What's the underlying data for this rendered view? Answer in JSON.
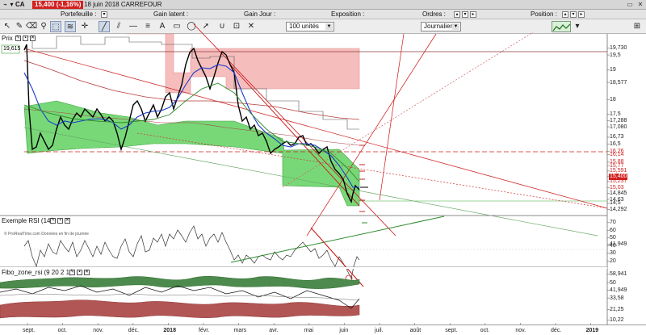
{
  "titlebar": {
    "symbol": "CA",
    "price_change": "15,400 (-1,16%)",
    "date_name": "18 juin 2018 CARREFOUR",
    "menu_arrow": "▾",
    "window_buttons": [
      "▭",
      "✕"
    ]
  },
  "info_row": [
    {
      "label": "Portefeuille :"
    },
    {
      "label": "Gain latent :"
    },
    {
      "label": "Gain Jour :"
    },
    {
      "label": "Exposition :"
    },
    {
      "label": "Ordres :"
    },
    {
      "label": "Position :"
    }
  ],
  "toolbar": {
    "quantity": "100 unités",
    "period": "Journalier"
  },
  "price_panel": {
    "label": "Prix",
    "left_badge": "19,615",
    "current_value": "15,400",
    "axis": [
      {
        "v": 19.73,
        "t": "19,730"
      },
      {
        "v": 19.5,
        "t": "19,5"
      },
      {
        "v": 19.0,
        "t": "19"
      },
      {
        "v": 18.577,
        "t": "18,577"
      },
      {
        "v": 18.0,
        "t": "18"
      },
      {
        "v": 17.5,
        "t": "17,5"
      },
      {
        "v": 17.288,
        "t": "17,288"
      },
      {
        "v": 17.08,
        "t": "17,080"
      },
      {
        "v": 16.73,
        "t": "16,73"
      },
      {
        "v": 16.5,
        "t": "16,5"
      },
      {
        "v": 16.26,
        "t": "16,26"
      },
      {
        "v": 16.14,
        "t": "16,14"
      },
      {
        "v": 15.89,
        "t": "15,88"
      },
      {
        "v": 15.775,
        "t": "15,77"
      },
      {
        "v": 15.591,
        "t": "15,591"
      },
      {
        "v": 15.4,
        "t": "15,40"
      },
      {
        "v": 15.237,
        "t": "15,237"
      },
      {
        "v": 15.035,
        "t": "15,03"
      },
      {
        "v": 14.845,
        "t": "14,845"
      },
      {
        "v": 14.634,
        "t": "14,63"
      },
      {
        "v": 14.5,
        "t": "14,5"
      },
      {
        "v": 14.292,
        "t": "14,292"
      }
    ],
    "watermark": "© ProRealTime.com  Données en fin de journée"
  },
  "rsi_panel": {
    "label": "Exemple RSI (14)",
    "axis": [
      {
        "v": 70,
        "t": "70"
      },
      {
        "v": 60,
        "t": "60"
      },
      {
        "v": 50,
        "t": "50"
      },
      {
        "v": 41.949,
        "t": "41,949"
      },
      {
        "v": 40,
        "t": "40"
      },
      {
        "v": 30,
        "t": "30"
      },
      {
        "v": 20,
        "t": "20"
      }
    ]
  },
  "fibo_panel": {
    "label": "Fibo_zone_rsi (9 20 2 1)",
    "axis": [
      {
        "v": 58.94,
        "t": "58,941"
      },
      {
        "v": 50,
        "t": "50"
      },
      {
        "v": 41.949,
        "t": "41,949"
      },
      {
        "v": 33.58,
        "t": "33,58"
      },
      {
        "v": 21.25,
        "t": "21,25"
      },
      {
        "v": 10.22,
        "t": "10,22"
      }
    ]
  },
  "xaxis": [
    {
      "t": "sept.",
      "bold": false
    },
    {
      "t": "oct.",
      "bold": false
    },
    {
      "t": "nov.",
      "bold": false
    },
    {
      "t": "déc.",
      "bold": false
    },
    {
      "t": "2018",
      "bold": true
    },
    {
      "t": "févr.",
      "bold": false
    },
    {
      "t": "mars",
      "bold": false
    },
    {
      "t": "avr.",
      "bold": false
    },
    {
      "t": "mai",
      "bold": false
    },
    {
      "t": "juin",
      "bold": false
    },
    {
      "t": "juil.",
      "bold": false
    },
    {
      "t": "août",
      "bold": false
    },
    {
      "t": "sept.",
      "bold": false
    },
    {
      "t": "oct.",
      "bold": false
    },
    {
      "t": "nov.",
      "bold": false
    },
    {
      "t": "déc.",
      "bold": false
    },
    {
      "t": "2019",
      "bold": true
    }
  ],
  "colors": {
    "ichimoku_cloud_bull": "#66cc66",
    "ichimoku_cloud_bear": "#f4b4b4",
    "price_line": "#000000",
    "ma_blue": "#1a3ccc",
    "trend_red": "#cc0000",
    "current_price": "#d42020"
  }
}
